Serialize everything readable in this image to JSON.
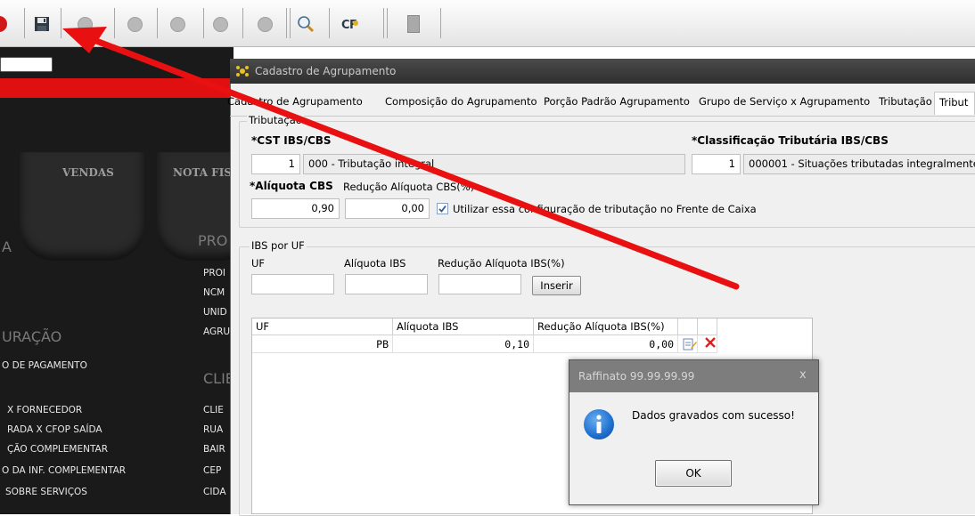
{
  "colors": {
    "accent_red": "#e01010",
    "arrow": "#e81010",
    "info_blue": "#1d6fcf"
  },
  "toolbar": {
    "icons": [
      "power-icon",
      "save-icon",
      "cancel-icon",
      "first-icon",
      "prev-icon",
      "next-icon",
      "last-icon",
      "search-icon",
      "cfop-icon",
      "exit-icon"
    ],
    "cfop_label": "CFOP"
  },
  "background_app": {
    "nav_tiles": [
      "VENDAS",
      "NOTA FIS"
    ],
    "section_left": "A",
    "section_left2": "URAÇÃO",
    "section_right": "PRO",
    "section_right2": "CLIE",
    "left_items": [
      "O DE PAGAMENTO",
      "X FORNECEDOR",
      "RADA X CFOP SAÍDA",
      "ÇÃO COMPLEMENTAR",
      "O DA INF. COMPLEMENTAR",
      "SOBRE SERVIÇOS"
    ],
    "right_items_top": [
      "PROI",
      "NCM",
      "UNID",
      "AGRU"
    ],
    "right_items_bottom": [
      "CLIE",
      "RUA",
      "BAIR",
      "CEP",
      "CIDA"
    ]
  },
  "window": {
    "title": "Cadastro de Agrupamento",
    "tabs": [
      "Cadastro de Agrupamento",
      "Composição do Agrupamento",
      "Porção Padrão Agrupamento",
      "Grupo de Serviço x Agrupamento",
      "Tributação",
      "Tribut"
    ],
    "active_tab_index": 5
  },
  "tributacao": {
    "legend": "Tributação",
    "cst_label": "*CST IBS/CBS",
    "cst_code": "1",
    "cst_desc": "000 - Tributação integral",
    "class_label": "*Classificação Tributária IBS/CBS",
    "class_code": "1",
    "class_desc": "000001 - Situações tributadas integralmente",
    "aliquota_cbs_label": "*Alíquota CBS",
    "aliquota_cbs_value": "0,90",
    "reducao_cbs_label": "Redução Alíquota CBS(%)",
    "reducao_cbs_value": "0,00",
    "checkbox_label": "Utilizar essa configuração de tributação no Frente de Caixa",
    "checkbox_checked": true
  },
  "ibs_uf": {
    "legend": "IBS por UF",
    "uf_label": "UF",
    "aliquota_label": "Alíquota IBS",
    "reducao_label": "Redução Alíquota IBS(%)",
    "uf_value": "",
    "aliquota_value": "",
    "reducao_value": "",
    "insert_button": "Inserir"
  },
  "grid": {
    "columns": [
      "UF",
      "Alíquota IBS",
      "Redução Alíquota IBS(%)"
    ],
    "rows": [
      {
        "uf": "PB",
        "aliquota": "0,10",
        "reducao": "0,00"
      }
    ]
  },
  "message": {
    "title": "Raffinato 99.99.99.99",
    "close": "x",
    "text": "Dados gravados com sucesso!",
    "ok": "OK"
  }
}
